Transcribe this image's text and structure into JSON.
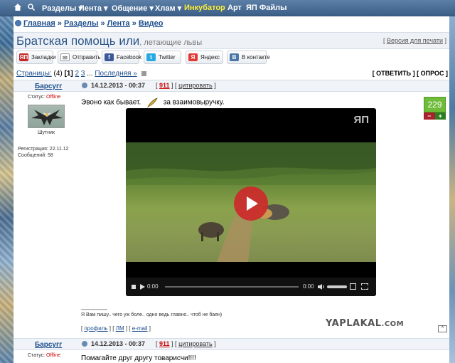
{
  "nav": {
    "items": [
      "Разделы ▾",
      "Лента ▾",
      "Общение ▾",
      "Хлам ▾",
      "Инкубатор",
      "Арт",
      "ЯП Файлы"
    ],
    "highlight_color": "#ffee33"
  },
  "breadcrumb": [
    "Главная",
    "Разделы",
    "Лента",
    "Видео"
  ],
  "topic": {
    "title": "Братская помощь или",
    "subtitle": ", летающие львы",
    "print_label": "Версия для печати"
  },
  "share": [
    {
      "label": "Закладки",
      "icon": "bookmark-icon",
      "color": "#c62828"
    },
    {
      "label": "Отправить",
      "icon": "mail-icon",
      "color": "#9e9e9e"
    },
    {
      "label": "Facebook",
      "icon": "facebook-icon",
      "color": "#3b5998"
    },
    {
      "label": "Twitter",
      "icon": "twitter-icon",
      "color": "#29a9e1"
    },
    {
      "label": "Яндекс",
      "icon": "yandex-icon",
      "color": "#e53935"
    },
    {
      "label": "В контакте",
      "icon": "vk-icon",
      "color": "#4a76a8"
    }
  ],
  "pagination": {
    "label": "Страницы:",
    "count": "(4)",
    "current": "[1]",
    "pages": [
      "2",
      "3"
    ],
    "last": "Последняя »"
  },
  "actions": {
    "reply": "[ ОТВЕТИТЬ ]",
    "poll": "[ ОПРОС ]"
  },
  "posts": [
    {
      "author": "Барсугг",
      "date": "14.12.2013 - 00:37",
      "number": "911",
      "quote": "цитировать",
      "status_label": "Статус:",
      "status": "Offline",
      "rank": "Шутник",
      "reg": "Регистрация: 22.11.12",
      "messages": "Сообщений: 58",
      "text_before": "Эвоно как бывает.",
      "text_after": "за взаимовыручку.",
      "rating": "229",
      "video": {
        "time_current": "0:00",
        "time_total": "0:00",
        "watermark": "ЯП"
      },
      "sig_dash": "--------------------",
      "signature": "Я Вам пишу.. чего уж боле.. одно ведь главно.. чтоб не баян)",
      "links": [
        "профиль",
        "ЛМ",
        "e-mail"
      ]
    },
    {
      "author": "Барсугг",
      "date": "14.12.2013 - 00:37",
      "number": "911",
      "quote": "цитировать",
      "status_label": "Статус:",
      "status": "Offline",
      "text": "Помагайте друг другу товарисчи!!!!"
    }
  ],
  "watermark": {
    "text": "YAPLAKAL",
    "suffix": ".COM"
  }
}
